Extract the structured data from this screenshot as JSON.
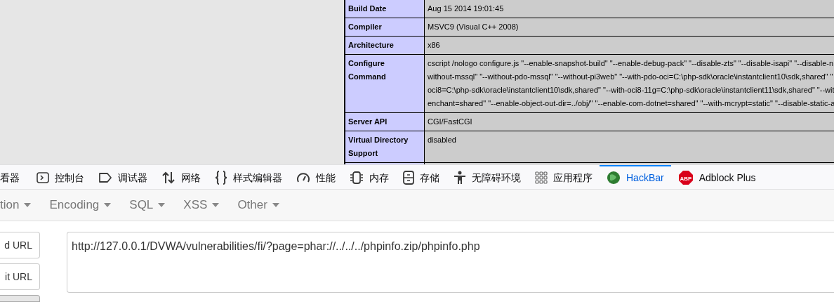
{
  "phpinfo_table": {
    "rows": [
      {
        "label": "Build Date",
        "lines": [
          "Aug 15 2014 19:01:45"
        ]
      },
      {
        "label": "Compiler",
        "lines": [
          "MSVC9 (Visual C++ 2008)"
        ]
      },
      {
        "label": "Architecture",
        "lines": [
          "x86"
        ]
      },
      {
        "label": "Configure Command",
        "lines": [
          "cscript /nologo configure.js \"--enable-snapshot-build\" \"--enable-debug-pack\" \"--disable-zts\" \"--disable-isapi\" \"--disable-n",
          "without-mssql\" \"--without-pdo-mssql\" \"--without-pi3web\" \"--with-pdo-oci=C:\\php-sdk\\oracle\\instantclient10\\sdk,shared\" \"",
          "oci8=C:\\php-sdk\\oracle\\instantclient10\\sdk,shared\" \"--with-oci8-11g=C:\\php-sdk\\oracle\\instantclient11\\sdk,shared\" \"--wit",
          "enchant=shared\" \"--enable-object-out-dir=../obj/\" \"--enable-com-dotnet=shared\" \"--with-mcrypt=static\" \"--disable-static-a"
        ]
      },
      {
        "label": "Server API",
        "lines": [
          "CGI/FastCGI"
        ]
      },
      {
        "label": "Virtual Directory Support",
        "lines": [
          "disabled"
        ]
      }
    ]
  },
  "devtools_tabs": [
    {
      "label": "看器",
      "kind": "plain",
      "selected": false
    },
    {
      "label": "控制台",
      "kind": "console",
      "selected": false
    },
    {
      "label": "调试器",
      "kind": "debugger",
      "selected": false
    },
    {
      "label": "网络",
      "kind": "network",
      "selected": false
    },
    {
      "label": "样式编辑器",
      "kind": "style",
      "selected": false
    },
    {
      "label": "性能",
      "kind": "performance",
      "selected": false
    },
    {
      "label": "内存",
      "kind": "memory",
      "selected": false
    },
    {
      "label": "存储",
      "kind": "storage",
      "selected": false
    },
    {
      "label": "无障碍环境",
      "kind": "accessibility",
      "selected": false
    },
    {
      "label": "应用程序",
      "kind": "application",
      "selected": false
    },
    {
      "label": "HackBar",
      "kind": "hackbar",
      "selected": true
    },
    {
      "label": "Adblock Plus",
      "kind": "adblock",
      "selected": false
    }
  ],
  "abp_icon_text": "ABP",
  "hackbar_menus": [
    "tion",
    "Encoding",
    "SQL",
    "XSS",
    "Other"
  ],
  "hackbar_buttons": [
    "d URL",
    "it URL"
  ],
  "url_field": {
    "value": "http://127.0.0.1/DVWA/vulnerabilities/fi/?page=phar://../../../phpinfo.zip/phpinfo.php"
  }
}
